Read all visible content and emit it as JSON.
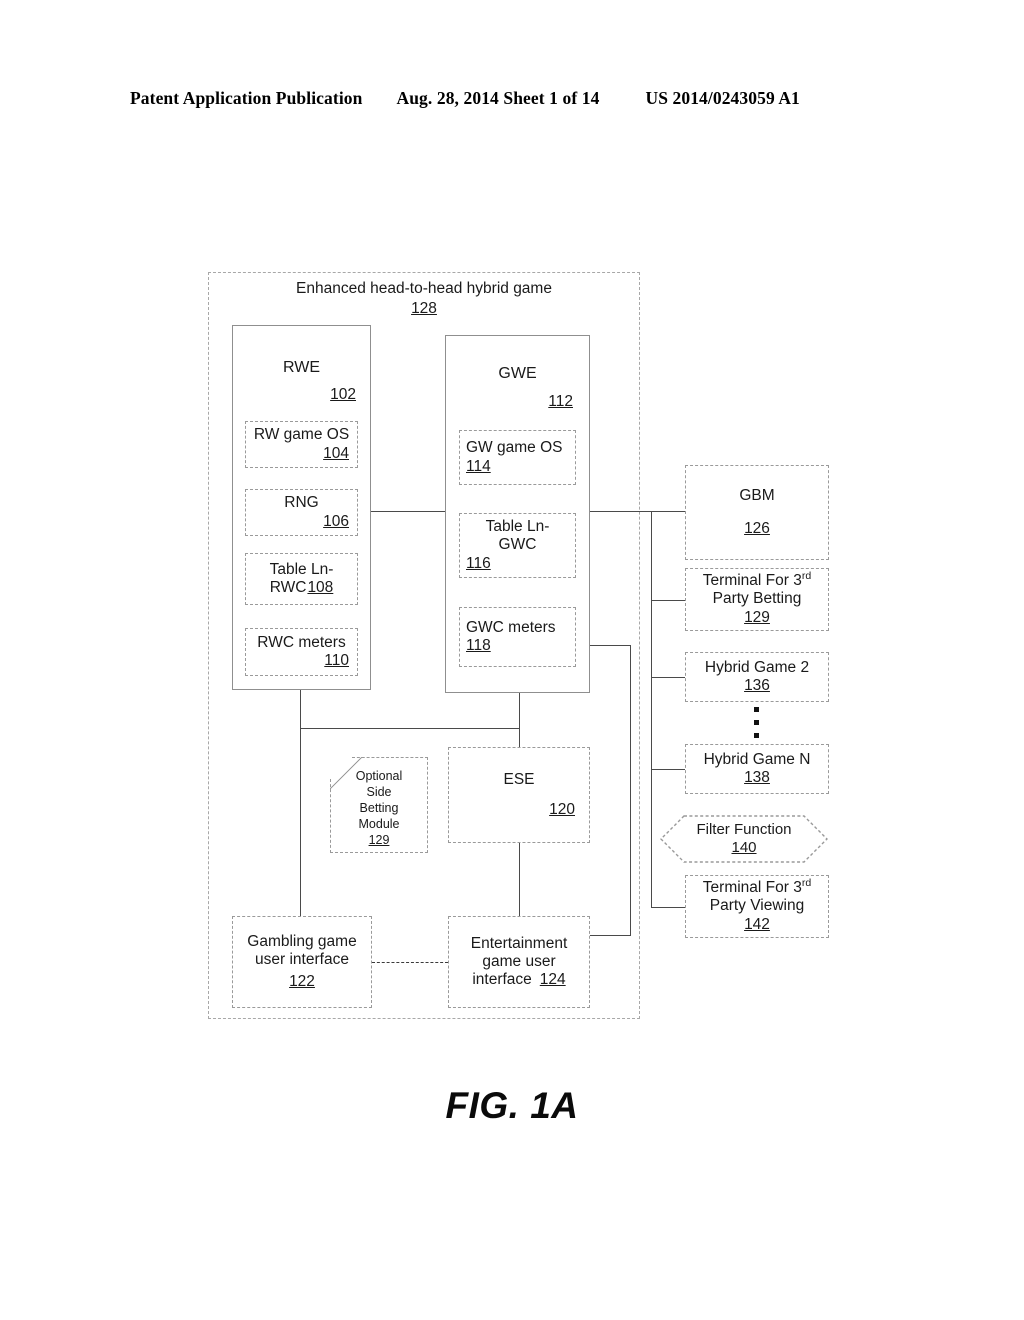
{
  "header": {
    "publication": "Patent Application Publication",
    "date_sheet": "Aug. 28, 2014  Sheet 1 of 14",
    "pub_number": "US 2014/0243059 A1"
  },
  "figure": {
    "caption": "FIG. 1A",
    "container": {
      "title": "Enhanced head-to-head hybrid game",
      "ref": "128"
    },
    "rwe": {
      "title": "RWE",
      "ref": "102",
      "children": [
        {
          "label": "RW game OS",
          "ref": "104"
        },
        {
          "label": "RNG",
          "ref": "106"
        },
        {
          "label": "Table Ln-RWC",
          "label_line1": "Table Ln-",
          "label_line2": "RWC",
          "ref": "108"
        },
        {
          "label": "RWC meters",
          "ref": "110"
        }
      ]
    },
    "gwe": {
      "title": "GWE",
      "ref": "112",
      "children": [
        {
          "label": "GW game OS",
          "ref": "114"
        },
        {
          "label": "Table Ln-GWC",
          "label_line1": "Table Ln-",
          "label_line2": "GWC",
          "ref": "116"
        },
        {
          "label": "GWC meters",
          "ref": "118"
        }
      ]
    },
    "ese": {
      "label": "ESE",
      "ref": "120"
    },
    "side_betting": {
      "line1": "Optional",
      "line2": "Side",
      "line3": "Betting",
      "line4": "Module",
      "ref": "129"
    },
    "gambling_ui": {
      "line1": "Gambling game",
      "line2": "user interface",
      "ref": "122"
    },
    "entertainment_ui": {
      "line1": "Entertainment",
      "line2": "game user",
      "line3": "interface",
      "ref": "124"
    },
    "right_column": {
      "gbm": {
        "label": "GBM",
        "ref": "126"
      },
      "terminal_betting": {
        "line1_pre": "Terminal For 3",
        "line1_sup": "rd",
        "line2": "Party Betting",
        "ref": "129"
      },
      "hybrid_game_2": {
        "label": "Hybrid Game 2",
        "ref": "136"
      },
      "ellipsis": "vertical-ellipsis",
      "hybrid_game_n": {
        "label": "Hybrid Game N",
        "ref": "138"
      },
      "filter_function": {
        "label": "Filter Function",
        "ref": "140"
      },
      "terminal_viewing": {
        "line1_pre": "Terminal For 3",
        "line1_sup": "rd",
        "line2": "Party Viewing",
        "ref": "142"
      }
    }
  },
  "colors": {
    "ink": "#1a1a1a",
    "line": "#4a4a4a",
    "dashed_border": "#9a9a9a",
    "page_bg": "#ffffff"
  }
}
